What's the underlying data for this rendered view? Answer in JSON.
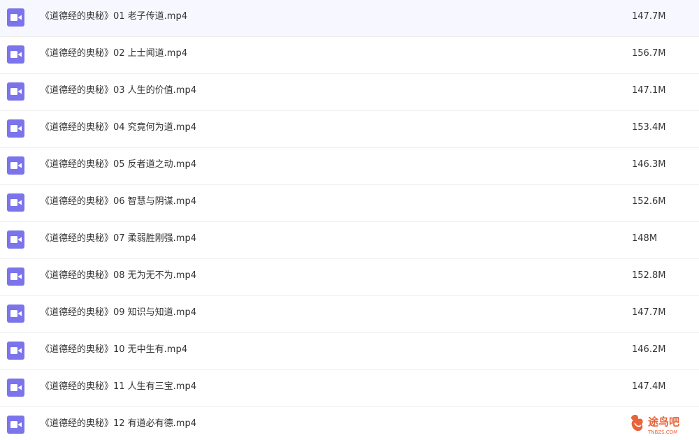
{
  "files": [
    {
      "name": "《道德经的奥秘》01 老子传道.mp4",
      "size": "147.7M",
      "icon": "video-file-icon"
    },
    {
      "name": "《道德经的奥秘》02 上士闻道.mp4",
      "size": "156.7M",
      "icon": "video-file-icon"
    },
    {
      "name": "《道德经的奥秘》03 人生的价值.mp4",
      "size": "147.1M",
      "icon": "video-file-icon"
    },
    {
      "name": "《道德经的奥秘》04 究竟何为道.mp4",
      "size": "153.4M",
      "icon": "video-file-icon"
    },
    {
      "name": "《道德经的奥秘》05 反者道之动.mp4",
      "size": "146.3M",
      "icon": "video-file-icon"
    },
    {
      "name": "《道德经的奥秘》06 智慧与阴谋.mp4",
      "size": "152.6M",
      "icon": "video-file-icon"
    },
    {
      "name": "《道德经的奥秘》07 柔弱胜刚强.mp4",
      "size": "148M",
      "icon": "video-file-icon"
    },
    {
      "name": "《道德经的奥秘》08 无为无不为.mp4",
      "size": "152.8M",
      "icon": "video-file-icon"
    },
    {
      "name": "《道德经的奥秘》09 知识与知道.mp4",
      "size": "147.7M",
      "icon": "video-file-icon"
    },
    {
      "name": "《道德经的奥秘》10 无中生有.mp4",
      "size": "146.2M",
      "icon": "video-file-icon"
    },
    {
      "name": "《道德经的奥秘》11 人生有三宝.mp4",
      "size": "147.4M",
      "icon": "video-file-icon"
    },
    {
      "name": "《道德经的奥秘》12 有道必有德.mp4",
      "size": "",
      "icon": "video-file-icon"
    }
  ],
  "watermark": {
    "text": "途鸟吧",
    "subtext": "TNBZS.COM",
    "icon": "bird-logo-icon"
  },
  "colors": {
    "icon_bg": "#7b74ea",
    "text": "#333333",
    "divider": "#eeeeee",
    "watermark": "#e8643c"
  }
}
